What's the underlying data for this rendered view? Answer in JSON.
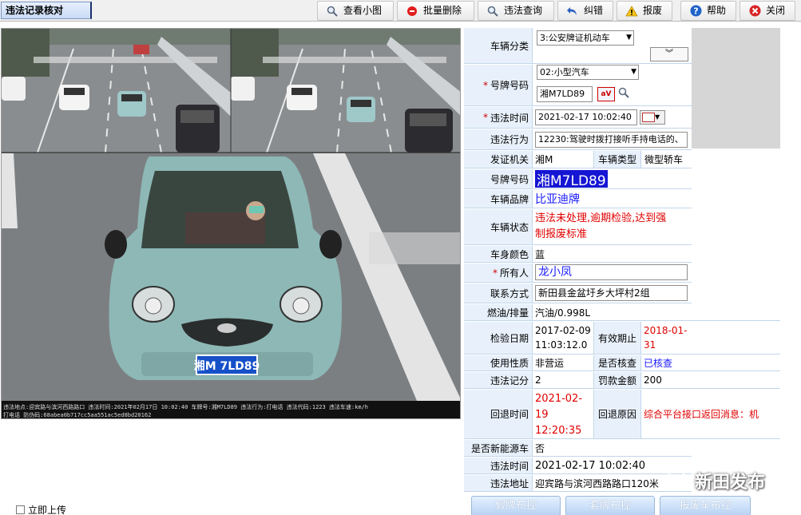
{
  "toolbar": {
    "tab_title": "违法记录核对",
    "view_thumbnail": "查看小图",
    "batch_delete": "批量删除",
    "violation_query": "违法查询",
    "correct": "纠错",
    "report_invalid": "报废",
    "help": "帮助",
    "close": "关闭"
  },
  "photo": {
    "caption_line1": "违法地点:迎宾路与滨河西路路口 违法时间:2021年02月17日 10:02:40 车牌号:湘M7LD89 违法行为:打电话 违法代码:1223 违法车速:km/h",
    "caption_line2": "打电话 防伪码:68abea0b717cc5aa551ac5ed8bd20162",
    "plate_small": "湘M 7LD89"
  },
  "form": {
    "vehicle_category": {
      "label": "车辆分类",
      "value": "3:公安牌证机动车"
    },
    "plate_type": {
      "label": "号牌号码",
      "select": "02:小型汽车",
      "value": "湘M7LD89"
    },
    "violation_time": {
      "label": "违法时间",
      "value": "2021-02-17 10:02:40"
    },
    "violation_act": {
      "label": "违法行为",
      "value": "12230:驾驶时拨打接听手持电话的、"
    },
    "issuing_authority": {
      "label": "发证机关",
      "value": "湘M"
    },
    "vehicle_type": {
      "label": "车辆类型",
      "value": "微型轿车"
    },
    "plate_number": {
      "label": "号牌号码",
      "value": "湘M7LD89"
    },
    "brand": {
      "label": "车辆品牌",
      "value": "比亚迪牌"
    },
    "status": {
      "label": "车辆状态",
      "value_line1": "违法未处理,逾期检验,达到强",
      "value_line2": "制报废标准"
    },
    "body_color": {
      "label": "车身颜色",
      "value": "蓝"
    },
    "owner": {
      "label": "所有人",
      "value": "龙小凤"
    },
    "contact": {
      "label": "联系方式",
      "value": "新田县金盆圩乡大坪村2组"
    },
    "fuel": {
      "label": "燃油/排量",
      "value": "汽油/0.998L"
    },
    "inspection_date": {
      "label": "检验日期",
      "value_line1": "2017-02-09",
      "value_line2": "11:03:12.0"
    },
    "valid_until": {
      "label": "有效期止",
      "value_line1": "2018-01-",
      "value_line2": "31"
    },
    "usage": {
      "label": "使用性质",
      "value": "非营运"
    },
    "verified": {
      "label": "是否核查",
      "value": "已核查"
    },
    "points": {
      "label": "违法记分",
      "value": "2"
    },
    "fine": {
      "label": "罚款金额",
      "value": "200"
    },
    "return_time": {
      "label": "回退时间",
      "value_line1": "2021-02-",
      "value_line2": "19",
      "value_line3": "12:20:35"
    },
    "return_reason": {
      "label": "回退原因",
      "value": "综合平台接口返回消息：机"
    },
    "new_energy": {
      "label": "是否新能源车",
      "value": "否"
    },
    "violation_time2": {
      "label": "违法时间",
      "value": "2021-02-17 10:02:40"
    },
    "violation_place": {
      "label": "违法地址",
      "value": "迎宾路与滨河西路路口120米"
    }
  },
  "bottom": {
    "upload_now": "立即上传",
    "fake_plate": "假牌布控",
    "cloned_plate": "套牌布控",
    "scrapped": "报废车布控"
  },
  "watermark": "新田发布"
}
